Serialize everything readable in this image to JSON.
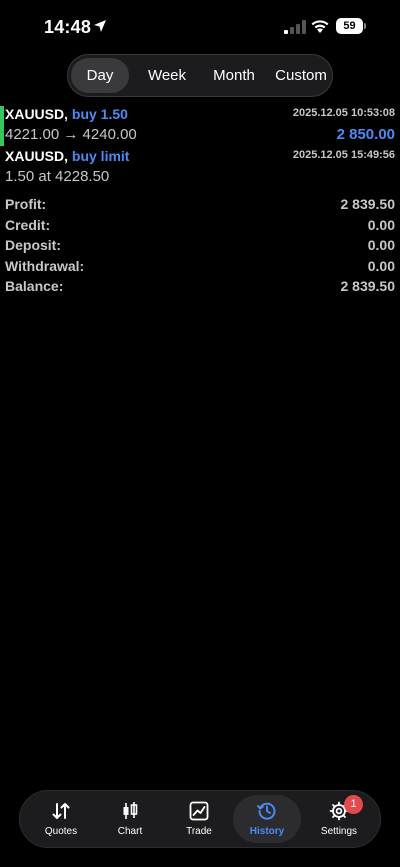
{
  "status_bar": {
    "time": "14:48",
    "battery": "59"
  },
  "segmented": {
    "items": [
      "Day",
      "Week",
      "Month",
      "Custom"
    ],
    "active": "Day"
  },
  "deals": [
    {
      "symbol": "XAUUSD,",
      "type": "buy 1.50",
      "time": "2025.12.05 10:53:08",
      "detail": "4221.00 → 4240.00",
      "profit": "2 850.00"
    },
    {
      "symbol": "XAUUSD,",
      "type": "buy limit",
      "time": "2025.12.05 15:49:56",
      "detail": "1.50 at 4228.50",
      "profit": ""
    }
  ],
  "summary": [
    {
      "label": "Profit:",
      "value": "2 839.50"
    },
    {
      "label": "Credit:",
      "value": "0.00"
    },
    {
      "label": "Deposit:",
      "value": "0.00"
    },
    {
      "label": "Withdrawal:",
      "value": "0.00"
    },
    {
      "label": "Balance:",
      "value": "2 839.50"
    }
  ],
  "tabbar": {
    "items": [
      {
        "label": "Quotes",
        "icon": "quotes-arrows-icon"
      },
      {
        "label": "Chart",
        "icon": "candlestick-icon"
      },
      {
        "label": "Trade",
        "icon": "trade-chart-icon"
      },
      {
        "label": "History",
        "icon": "history-clock-icon"
      },
      {
        "label": "Settings",
        "icon": "gear-icon"
      }
    ],
    "active": "History",
    "settings_badge": "1"
  },
  "colors": {
    "accent": "#4a8cf7",
    "buy_bar": "#35c759",
    "badge": "#e5484d"
  }
}
